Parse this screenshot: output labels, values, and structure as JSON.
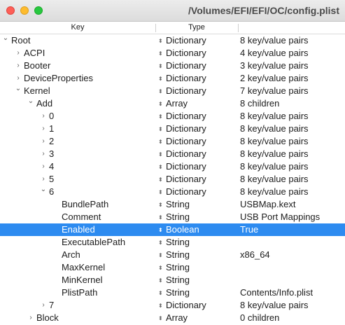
{
  "window": {
    "title": "/Volumes/EFI/EFI/OC/config.plist"
  },
  "header": {
    "key": "Key",
    "type": "Type",
    "value": ""
  },
  "colors": {
    "selection": "#2d8bf0",
    "close": "#fe5f57",
    "minimize": "#febc2e",
    "zoom": "#28c840"
  },
  "rows": [
    {
      "key": "Root",
      "type": "Dictionary",
      "value": "8 key/value pairs",
      "level": 0,
      "disclosure": "expanded"
    },
    {
      "key": "ACPI",
      "type": "Dictionary",
      "value": "4 key/value pairs",
      "level": 1,
      "disclosure": "collapsed"
    },
    {
      "key": "Booter",
      "type": "Dictionary",
      "value": "3 key/value pairs",
      "level": 1,
      "disclosure": "collapsed"
    },
    {
      "key": "DeviceProperties",
      "type": "Dictionary",
      "value": "2 key/value pairs",
      "level": 1,
      "disclosure": "collapsed"
    },
    {
      "key": "Kernel",
      "type": "Dictionary",
      "value": "7 key/value pairs",
      "level": 1,
      "disclosure": "expanded"
    },
    {
      "key": "Add",
      "type": "Array",
      "value": "8 children",
      "level": 2,
      "disclosure": "expanded"
    },
    {
      "key": "0",
      "type": "Dictionary",
      "value": "8 key/value pairs",
      "level": 3,
      "disclosure": "collapsed"
    },
    {
      "key": "1",
      "type": "Dictionary",
      "value": "8 key/value pairs",
      "level": 3,
      "disclosure": "collapsed"
    },
    {
      "key": "2",
      "type": "Dictionary",
      "value": "8 key/value pairs",
      "level": 3,
      "disclosure": "collapsed"
    },
    {
      "key": "3",
      "type": "Dictionary",
      "value": "8 key/value pairs",
      "level": 3,
      "disclosure": "collapsed"
    },
    {
      "key": "4",
      "type": "Dictionary",
      "value": "8 key/value pairs",
      "level": 3,
      "disclosure": "collapsed"
    },
    {
      "key": "5",
      "type": "Dictionary",
      "value": "8 key/value pairs",
      "level": 3,
      "disclosure": "collapsed"
    },
    {
      "key": "6",
      "type": "Dictionary",
      "value": "8 key/value pairs",
      "level": 3,
      "disclosure": "expanded"
    },
    {
      "key": "BundlePath",
      "type": "String",
      "value": "USBMap.kext",
      "level": 4,
      "disclosure": "none"
    },
    {
      "key": "Comment",
      "type": "String",
      "value": "USB Port Mappings",
      "level": 4,
      "disclosure": "none"
    },
    {
      "key": "Enabled",
      "type": "Boolean",
      "value": "True",
      "level": 4,
      "disclosure": "none",
      "selected": true
    },
    {
      "key": "ExecutablePath",
      "type": "String",
      "value": "",
      "level": 4,
      "disclosure": "none"
    },
    {
      "key": "Arch",
      "type": "String",
      "value": "x86_64",
      "level": 4,
      "disclosure": "none"
    },
    {
      "key": "MaxKernel",
      "type": "String",
      "value": "",
      "level": 4,
      "disclosure": "none"
    },
    {
      "key": "MinKernel",
      "type": "String",
      "value": "",
      "level": 4,
      "disclosure": "none"
    },
    {
      "key": "PlistPath",
      "type": "String",
      "value": "Contents/Info.plist",
      "level": 4,
      "disclosure": "none"
    },
    {
      "key": "7",
      "type": "Dictionary",
      "value": "8 key/value pairs",
      "level": 3,
      "disclosure": "collapsed"
    },
    {
      "key": "Block",
      "type": "Array",
      "value": "0 children",
      "level": 2,
      "disclosure": "collapsed"
    }
  ]
}
